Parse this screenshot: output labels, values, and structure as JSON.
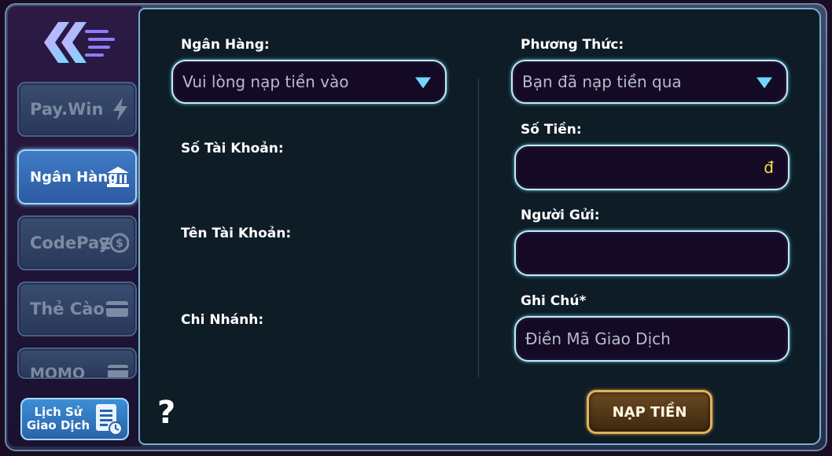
{
  "sidebar": {
    "back_icon": "double-chevron-left-icon",
    "items": [
      {
        "label": "Pay.Win",
        "icon": "lightning-icon",
        "active": false
      },
      {
        "label": "Ngân Hàng",
        "icon": "bank-icon",
        "active": true
      },
      {
        "label": "CodePay",
        "icon": "coin-stack-icon",
        "active": false
      },
      {
        "label": "Thẻ Cào",
        "icon": "card-icon",
        "active": false
      },
      {
        "label": "MOMO",
        "icon": "wallet-icon",
        "active": false
      }
    ],
    "history_label_line1": "Lịch Sử",
    "history_label_line2": "Giao Dịch"
  },
  "form": {
    "bank_label": "Ngân Hàng:",
    "bank_select": "Vui lòng nạp tiền vào",
    "account_number_label": "Số Tài Khoản:",
    "account_name_label": "Tên Tài Khoản:",
    "branch_label": "Chi Nhánh:",
    "method_label": "Phương Thức:",
    "method_select": "Bạn đã nạp tiền qua",
    "amount_label": "Số Tiền:",
    "amount_value": "",
    "currency_symbol": "đ",
    "sender_label": "Người Gửi:",
    "sender_value": "",
    "note_label": "Ghi Chú*",
    "note_placeholder": "Điền Mã Giao Dịch",
    "help_symbol": "?",
    "submit_label": "NẠP TIỀN"
  },
  "colors": {
    "accent_cyan": "#6fd7ff",
    "active_tab": "#3f7cc6",
    "submit_gold": "#e0b35a",
    "currency_yellow": "#f2e14a"
  }
}
